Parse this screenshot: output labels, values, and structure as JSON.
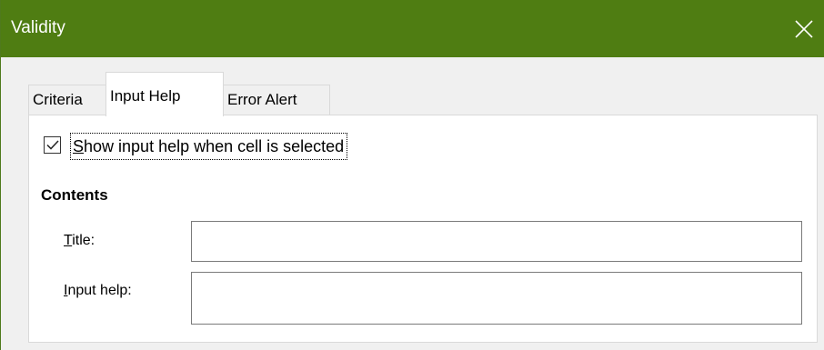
{
  "window": {
    "title": "Validity"
  },
  "tabs": [
    {
      "label": "Criteria",
      "active": false
    },
    {
      "label": "Input Help",
      "active": true
    },
    {
      "label": "Error Alert",
      "active": false
    }
  ],
  "input_help": {
    "show_checkbox": {
      "label_mnemonic": "S",
      "label_rest": "how input help when cell is selected",
      "checked": true
    },
    "contents_title": "Contents",
    "title_field": {
      "label_mnemonic": "T",
      "label_rest": "itle:",
      "value": ""
    },
    "help_field": {
      "label_mnemonic": "I",
      "label_rest": "nput help:",
      "value": ""
    }
  },
  "colors": {
    "titlebar": "#4f7d12",
    "title_text": "#ffffff",
    "panel_bg": "#ffffff",
    "dialog_bg": "#f0f0f0"
  },
  "icons": {
    "close": "close-icon",
    "check": "check-icon"
  }
}
